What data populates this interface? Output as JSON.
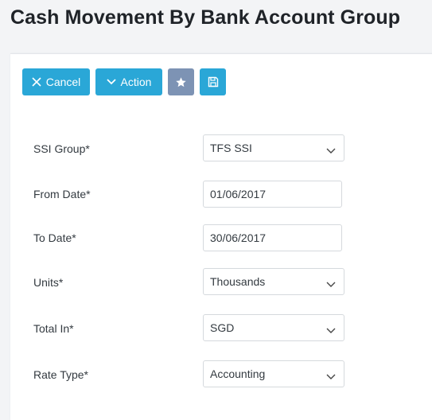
{
  "page": {
    "title": "Cash Movement By Bank Account Group"
  },
  "toolbar": {
    "cancel_label": "Cancel",
    "action_label": "Action",
    "cancel_icon": "close-icon",
    "action_icon": "chevron-down-icon",
    "favorite_icon": "star-icon",
    "save_icon": "save-icon"
  },
  "form": {
    "ssi_group": {
      "label": "SSI Group*",
      "value": "TFS SSI"
    },
    "from_date": {
      "label": "From Date*",
      "value": "01/06/2017"
    },
    "to_date": {
      "label": "To Date*",
      "value": "30/06/2017"
    },
    "units": {
      "label": "Units*",
      "value": "Thousands"
    },
    "total_in": {
      "label": "Total In*",
      "value": "SGD"
    },
    "rate_type": {
      "label": "Rate Type*",
      "value": "Accounting"
    }
  },
  "colors": {
    "primary": "#2aa7d7",
    "favorite": "#7d93b4",
    "background": "#f3f4f6",
    "panel": "#ffffff"
  }
}
